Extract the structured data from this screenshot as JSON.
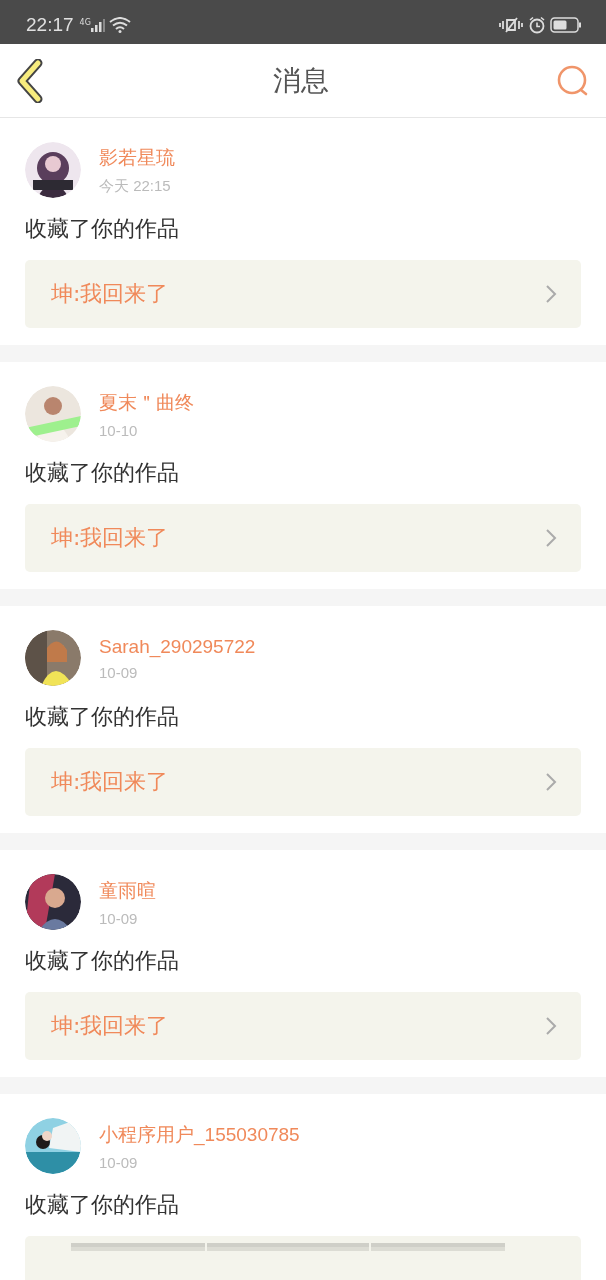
{
  "status_bar": {
    "time": "22:17",
    "network": "4G"
  },
  "header": {
    "title": "消息"
  },
  "messages": [
    {
      "name": "影若星琉",
      "time": "今天 22:15",
      "action": "收藏了你的作品",
      "attachment": {
        "kind": "text",
        "text": "坤:我回来了"
      }
    },
    {
      "name": "夏末＂曲终",
      "time": "10-10",
      "action": "收藏了你的作品",
      "attachment": {
        "kind": "text",
        "text": "坤:我回来了"
      }
    },
    {
      "name": "Sarah_290295722",
      "time": "10-09",
      "action": "收藏了你的作品",
      "attachment": {
        "kind": "text",
        "text": "坤:我回来了"
      }
    },
    {
      "name": "童雨暄",
      "time": "10-09",
      "action": "收藏了你的作品",
      "attachment": {
        "kind": "text",
        "text": "坤:我回来了"
      }
    },
    {
      "name": "小程序用户_155030785",
      "time": "10-09",
      "action": "收藏了你的作品",
      "attachment": {
        "kind": "images"
      }
    }
  ]
}
